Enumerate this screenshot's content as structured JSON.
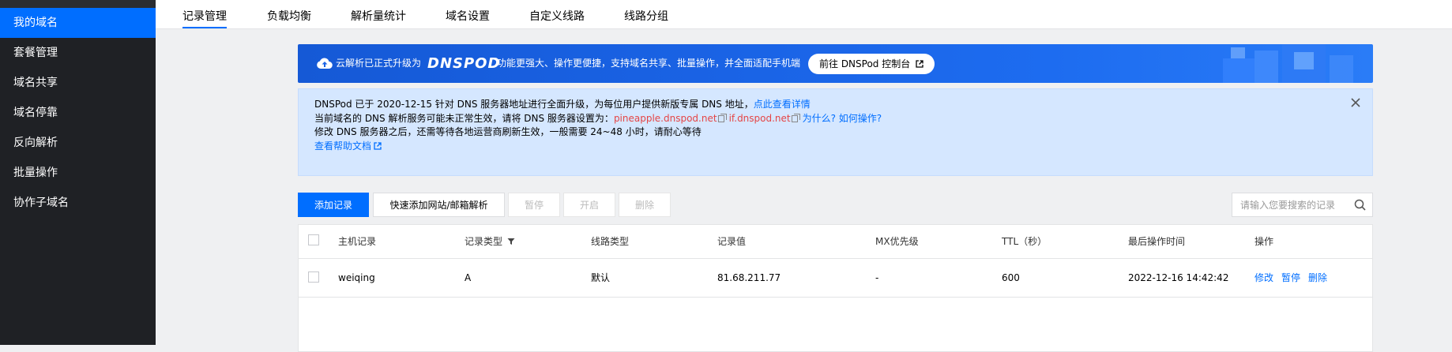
{
  "sidebar": {
    "items": [
      {
        "label": "我的域名",
        "active": true
      },
      {
        "label": "套餐管理"
      },
      {
        "label": "域名共享"
      },
      {
        "label": "域名停靠"
      },
      {
        "label": "反向解析"
      },
      {
        "label": "批量操作"
      },
      {
        "label": "协作子域名"
      }
    ]
  },
  "tabs": [
    {
      "label": "记录管理",
      "active": true
    },
    {
      "label": "负载均衡"
    },
    {
      "label": "解析量统计"
    },
    {
      "label": "域名设置"
    },
    {
      "label": "自定义线路"
    },
    {
      "label": "线路分组"
    }
  ],
  "banner": {
    "prefix": "云解析已正式升级为",
    "brand": "DNSPOD",
    "text": "功能更强大、操作更便捷，支持域名共享、批量操作，并全面适配手机端",
    "button": "前往 DNSPod 控制台"
  },
  "notice": {
    "line1": "DNSPod 已于 2020-12-15 针对 DNS 服务器地址进行全面升级，为每位用户提供新版专属 DNS 地址，",
    "line1_link": "点此查看详情",
    "line2_prefix": "当前域名的 DNS 解析服务可能未正常生效，请将 DNS 服务器设置为：",
    "ns1": "pineapple.dnspod.net",
    "ns2": "if.dnspod.net",
    "line2_link": "为什么? 如何操作?",
    "line3": "修改 DNS 服务器之后，还需等待各地运营商刷新生效，一般需要 24~48 小时，请耐心等待",
    "help_link": "查看帮助文档"
  },
  "toolbar": {
    "add": "添加记录",
    "quick_add": "快速添加网站/邮箱解析",
    "pause": "暂停",
    "enable": "开启",
    "delete": "删除",
    "search_placeholder": "请输入您要搜索的记录"
  },
  "table": {
    "headers": {
      "host": "主机记录",
      "type": "记录类型",
      "line": "线路类型",
      "value": "记录值",
      "mx": "MX优先级",
      "ttl": "TTL（秒）",
      "time": "最后操作时间",
      "ops": "操作"
    },
    "rows": [
      {
        "host": "weiqing",
        "type": "A",
        "line": "默认",
        "value": "81.68.211.77",
        "mx": "-",
        "ttl": "600",
        "time": "2022-12-16 14:42:42",
        "op_edit": "修改",
        "op_pause": "暂停",
        "op_delete": "删除"
      }
    ]
  },
  "colors": {
    "accent": "#006eff",
    "sidebar_bg": "#1f2125",
    "notice_bg": "#d5e7ff",
    "ns_red": "#e54545"
  }
}
